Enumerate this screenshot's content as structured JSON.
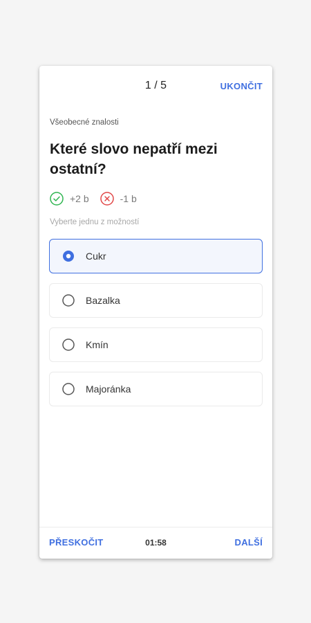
{
  "header": {
    "counter": "1 / 5",
    "end_label": "UKONČIT"
  },
  "question": {
    "category": "Všeobecné znalosti",
    "text": "Které slovo nepatří mezi ostatní?",
    "correct_points": "+2 b",
    "wrong_points": "-1 b",
    "hint": "Vyberte jednu z možností"
  },
  "options": [
    {
      "label": "Cukr",
      "selected": true
    },
    {
      "label": "Bazalka",
      "selected": false
    },
    {
      "label": "Kmín",
      "selected": false
    },
    {
      "label": "Majoránka",
      "selected": false
    }
  ],
  "footer": {
    "skip_label": "PŘESKOČIT",
    "timer": "01:58",
    "next_label": "DALŠÍ"
  },
  "colors": {
    "accent": "#3f6fe0",
    "correct": "#2fb550",
    "wrong": "#e14848",
    "background": "#f5f5f5"
  },
  "icons": {
    "correct": "check-circle-icon",
    "wrong": "x-circle-icon"
  }
}
